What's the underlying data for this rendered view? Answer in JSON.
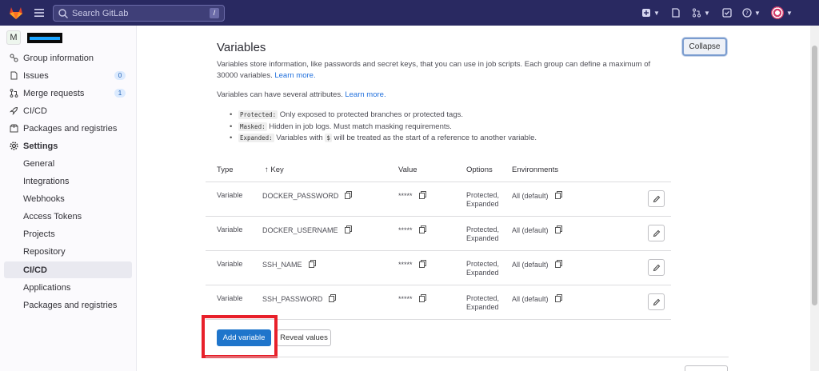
{
  "topbar": {
    "search_placeholder": "Search GitLab",
    "search_shortcut": "/"
  },
  "sidebar": {
    "group_avatar_letter": "M",
    "items": [
      {
        "label": "Group information"
      },
      {
        "label": "Issues",
        "count": "0"
      },
      {
        "label": "Merge requests",
        "count": "1"
      },
      {
        "label": "CI/CD"
      },
      {
        "label": "Packages and registries"
      },
      {
        "label": "Settings"
      },
      {
        "label": "General"
      },
      {
        "label": "Integrations"
      },
      {
        "label": "Webhooks"
      },
      {
        "label": "Access Tokens"
      },
      {
        "label": "Projects"
      },
      {
        "label": "Repository"
      },
      {
        "label": "CI/CD"
      },
      {
        "label": "Applications"
      },
      {
        "label": "Packages and registries"
      }
    ]
  },
  "main": {
    "title": "Variables",
    "collapse_label": "Collapse",
    "description": "Variables store information, like passwords and secret keys, that you can use in job scripts. Each group can define a maximum of 30000 variables.",
    "learn_more": "Learn more.",
    "attributes_text": "Variables can have several attributes.",
    "attributes_learn_more": "Learn more.",
    "bullets": [
      {
        "code": "Protected:",
        "text": "Only exposed to protected branches or protected tags."
      },
      {
        "code": "Masked:",
        "text": "Hidden in job logs. Must match masking requirements."
      },
      {
        "code": "Expanded:",
        "text_before": "Variables with",
        "inline_code": "$",
        "text_after": "will be treated as the start of a reference to another variable."
      }
    ],
    "table": {
      "headers": {
        "type": "Type",
        "key": "↑ Key",
        "value": "Value",
        "options": "Options",
        "environments": "Environments"
      },
      "rows": [
        {
          "type": "Variable",
          "key": "DOCKER_PASSWORD",
          "value": "*****",
          "options_1": "Protected,",
          "options_2": "Expanded",
          "environment": "All (default)"
        },
        {
          "type": "Variable",
          "key": "DOCKER_USERNAME",
          "value": "*****",
          "options_1": "Protected,",
          "options_2": "Expanded",
          "environment": "All (default)"
        },
        {
          "type": "Variable",
          "key": "SSH_NAME",
          "value": "*****",
          "options_1": "Protected,",
          "options_2": "Expanded",
          "environment": "All (default)"
        },
        {
          "type": "Variable",
          "key": "SSH_PASSWORD",
          "value": "*****",
          "options_1": "Protected,",
          "options_2": "Expanded",
          "environment": "All (default)"
        }
      ]
    },
    "add_variable_label": "Add variable",
    "reveal_values_label": "Reveal values"
  },
  "colors": {
    "topbar": "#292961",
    "primary_button": "#1f75cb",
    "highlight": "#e8202a"
  }
}
